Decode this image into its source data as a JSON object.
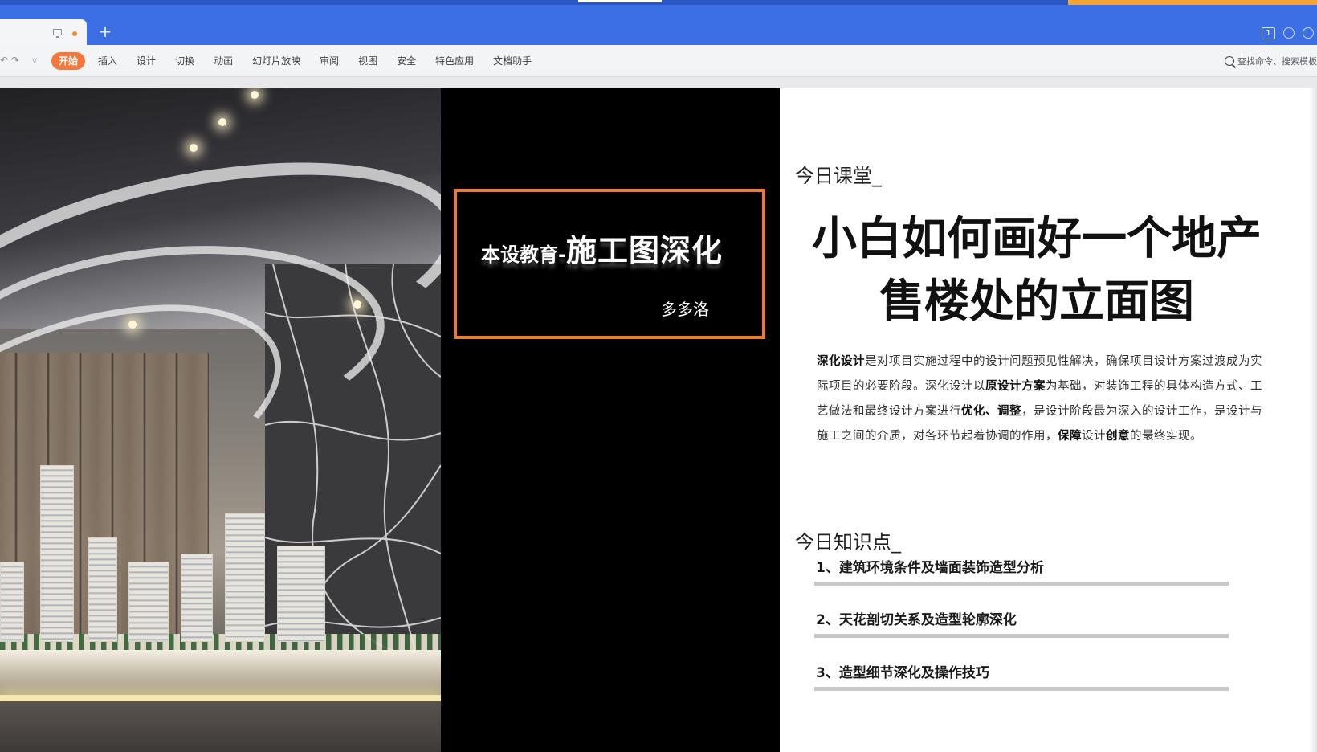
{
  "window": {
    "new_tab_label": "+",
    "page_badge": "1"
  },
  "ribbon": {
    "menu": [
      {
        "label": "开始",
        "active": true
      },
      {
        "label": "插入"
      },
      {
        "label": "设计"
      },
      {
        "label": "切换"
      },
      {
        "label": "动画"
      },
      {
        "label": "幻灯片放映"
      },
      {
        "label": "审阅"
      },
      {
        "label": "视图"
      },
      {
        "label": "安全"
      },
      {
        "label": "特色应用"
      },
      {
        "label": "文档助手"
      }
    ],
    "search_placeholder": "查找命令、搜索模板"
  },
  "slide": {
    "frame": {
      "title_small": "本设教育-",
      "title_big": "施工图深化",
      "author": "多多洛",
      "border_color": "#ec7d2f"
    },
    "today_class_label": "今日课堂_",
    "main_title": "小白如何画好一个地产售楼处的立面图",
    "paragraph": {
      "p1_bold": "深化设计",
      "p1": "是对项目实施过程中的设计问题预见性解决，确保项目设计方案过渡成为实际项目的必要阶段。深化设计以",
      "p2_bold": "原设计方案",
      "p2": "为基础，对装饰工程的具体构造方式、工艺做法和最终设计方案进行",
      "p3_bold": "优化、调整",
      "p3": "，是设计阶段最为深入的设计工作，是设计与施工之间的介质，对各环节起着协调的作用，",
      "p4_bold": "保障",
      "p4": "设计",
      "p5_bold": "创意",
      "p5": "的最终实现。"
    },
    "knowledge_label": "今日知识点_",
    "points": [
      "1、建筑环境条件及墙面装饰造型分析",
      "2、天花剖切关系及造型轮廓深化",
      "3、造型细节深化及操作技巧"
    ]
  },
  "colors": {
    "titlebar": "#3b6fe3",
    "accent": "#f4783c"
  }
}
